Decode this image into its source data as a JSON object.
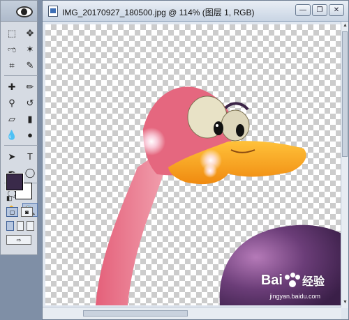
{
  "document": {
    "title": "IMG_20170927_180500.jpg @ 114% (图层 1, RGB)",
    "window_buttons": {
      "minimize": "—",
      "restore": "❐",
      "close": "✕"
    }
  },
  "toolbox": {
    "tools": [
      {
        "name": "marquee-tool",
        "glyph": "⬚"
      },
      {
        "name": "move-tool",
        "glyph": "✥"
      },
      {
        "name": "lasso-tool",
        "glyph": "ಌ"
      },
      {
        "name": "magic-wand-tool",
        "glyph": "✶"
      },
      {
        "name": "crop-tool",
        "glyph": "⌗"
      },
      {
        "name": "slice-tool",
        "glyph": "✎"
      },
      {
        "name": "healing-brush-tool",
        "glyph": "✚"
      },
      {
        "name": "brush-tool",
        "glyph": "✏"
      },
      {
        "name": "clone-stamp-tool",
        "glyph": "⚲"
      },
      {
        "name": "history-brush-tool",
        "glyph": "↺"
      },
      {
        "name": "eraser-tool",
        "glyph": "▱"
      },
      {
        "name": "gradient-tool",
        "glyph": "▮"
      },
      {
        "name": "blur-tool",
        "glyph": "💧"
      },
      {
        "name": "dodge-tool",
        "glyph": "●"
      },
      {
        "name": "path-select-tool",
        "glyph": "➤"
      },
      {
        "name": "type-tool",
        "glyph": "T"
      },
      {
        "name": "pen-tool",
        "glyph": "✒"
      },
      {
        "name": "shape-tool",
        "glyph": "◯"
      },
      {
        "name": "notes-tool",
        "glyph": "🗨"
      },
      {
        "name": "eyedropper-tool",
        "glyph": "⁄"
      },
      {
        "name": "hand-tool",
        "glyph": "✋"
      },
      {
        "name": "zoom-tool",
        "glyph": "🔍"
      }
    ],
    "foreground_color": "#3a2a4a",
    "background_color": "#ffffff"
  },
  "watermark": {
    "brand": "Bai",
    "brand_cn": "经验",
    "url": "jingyan.baidu.com"
  }
}
